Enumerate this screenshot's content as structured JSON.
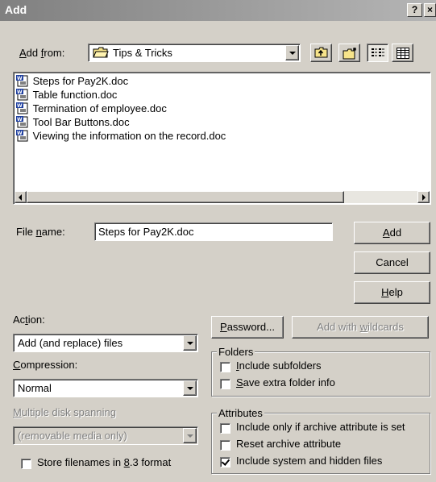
{
  "window": {
    "title": "Add",
    "help_label": "?",
    "close_label": "×"
  },
  "toolbar": {
    "add_from_label": "Add from:",
    "add_from_value": "Tips & Tricks"
  },
  "files": [
    "Steps for Pay2K.doc",
    "Table function.doc",
    "Termination of employee.doc",
    "Tool Bar Buttons.doc",
    "Viewing the information on the record.doc"
  ],
  "file_name": {
    "label": "File name:",
    "value": "Steps for Pay2K.doc"
  },
  "buttons": {
    "add": "Add",
    "cancel": "Cancel",
    "help": "Help",
    "password": "Password...",
    "add_wildcards": "Add with wildcards"
  },
  "action": {
    "label": "Action:",
    "value": "Add (and replace) files"
  },
  "compression": {
    "label": "Compression:",
    "value": "Normal"
  },
  "spanning": {
    "label": "Multiple disk spanning",
    "value": "(removable media only)"
  },
  "store_83": {
    "label": "Store filenames in 8.3 format",
    "checked": false
  },
  "folders": {
    "title": "Folders",
    "include_subfolders": "Include subfolders",
    "save_extra": "Save extra folder info"
  },
  "attributes": {
    "title": "Attributes",
    "archive_only": "Include only if archive attribute is set",
    "reset_archive": "Reset archive attribute",
    "system_hidden": "Include system and hidden files"
  },
  "colors": {
    "face": "#d4d0c8",
    "title_start": "#808080",
    "disabled_text": "#808080"
  }
}
